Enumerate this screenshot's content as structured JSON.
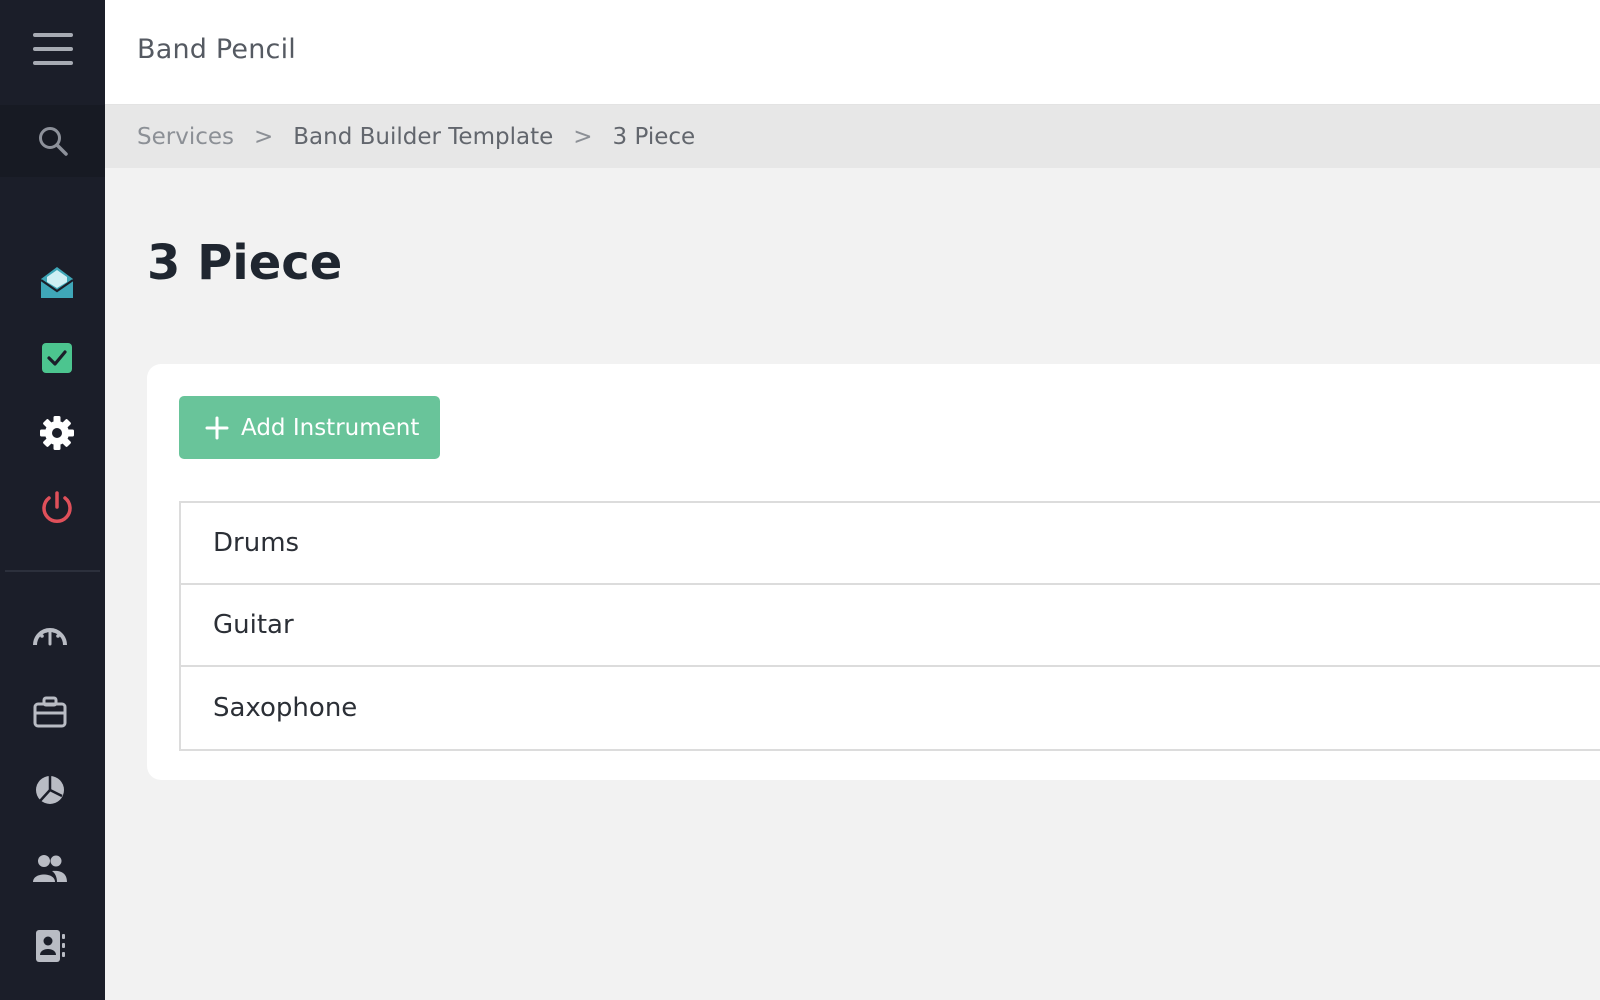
{
  "app": {
    "title": "Band Pencil"
  },
  "sidebar": {
    "menu_icon": "hamburger-menu-icon",
    "search_icon": "search-icon",
    "top_items": [
      {
        "name": "inbox",
        "icon": "envelope-open-icon",
        "color": "#3fa7b8"
      },
      {
        "name": "tasks",
        "icon": "checkbox-icon",
        "color": "#4cc58f"
      },
      {
        "name": "settings",
        "icon": "gear-icon",
        "color": "#ffffff"
      },
      {
        "name": "logout",
        "icon": "power-icon",
        "color": "#e0505a"
      }
    ],
    "bottom_items": [
      {
        "name": "dashboard",
        "icon": "speedometer-icon"
      },
      {
        "name": "services",
        "icon": "briefcase-icon"
      },
      {
        "name": "reports",
        "icon": "pie-chart-icon"
      },
      {
        "name": "users",
        "icon": "users-icon"
      },
      {
        "name": "contacts",
        "icon": "address-book-icon"
      }
    ]
  },
  "breadcrumb": {
    "items": [
      "Services",
      "Band Builder Template",
      "3 Piece"
    ],
    "separator": ">"
  },
  "page": {
    "title": "3 Piece"
  },
  "card": {
    "add_button_label": "Add Instrument",
    "add_button_color": "#69c49a",
    "instruments": [
      "Drums",
      "Guitar",
      "Saxophone"
    ]
  }
}
